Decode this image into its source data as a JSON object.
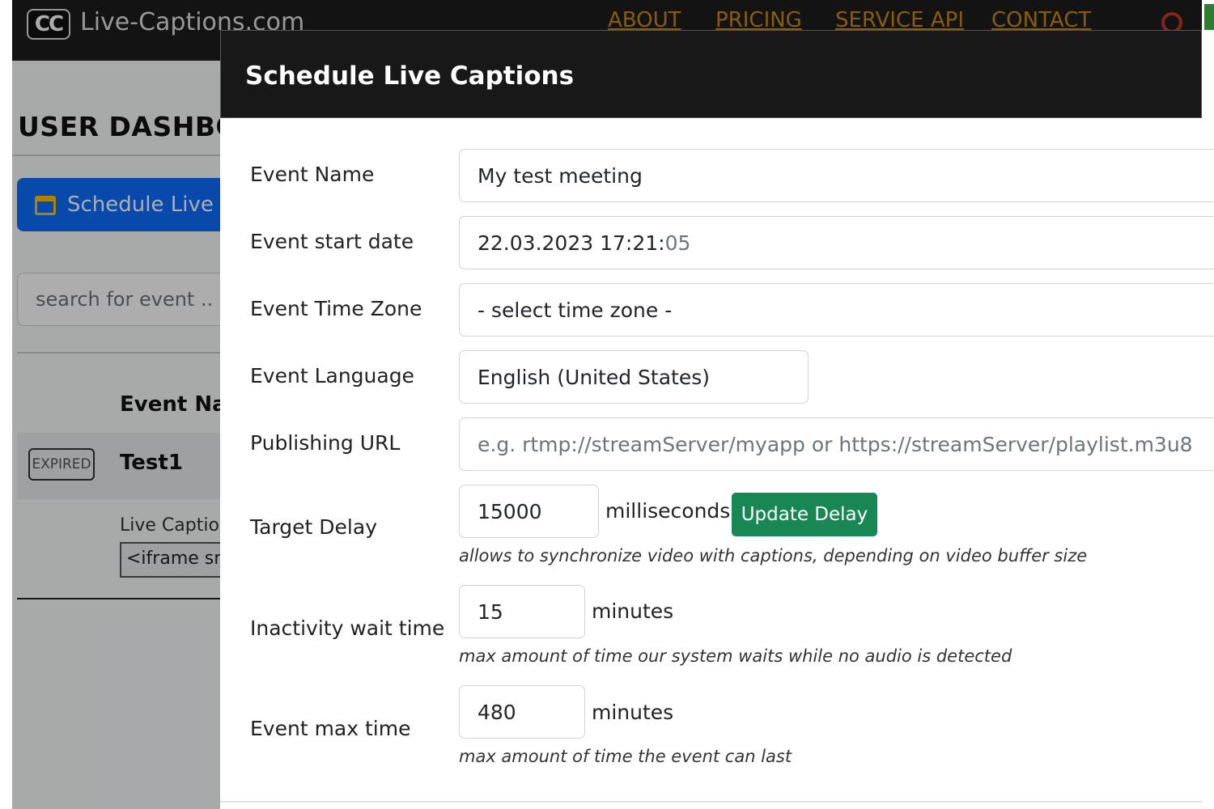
{
  "navbar": {
    "logo": "CC",
    "brand": "Live-Captions.com",
    "links": [
      "ABOUT",
      "PRICING",
      "SERVICE API",
      "CONTACT"
    ]
  },
  "dashboard": {
    "title": "USER DASHBOA",
    "schedule_button": "Schedule Live C",
    "search_placeholder": "search for event ..",
    "column_header": "Event Nar",
    "row": {
      "status": "EXPIRED",
      "name": "Test1"
    },
    "live_captions_label": "Live Caption",
    "iframe_code": "<iframe src"
  },
  "modal": {
    "title": "Schedule Live Captions",
    "fields": {
      "event_name": {
        "label": "Event Name",
        "value": "My test meeting"
      },
      "start_date": {
        "label": "Event start date",
        "value": "22.03.2023 17:21:",
        "seconds": "05"
      },
      "time_zone": {
        "label": "Event Time Zone",
        "value": "- select time zone -"
      },
      "language": {
        "label": "Event Language",
        "value": "English (United States)"
      },
      "publishing_url": {
        "label": "Publishing URL",
        "placeholder": "e.g. rtmp://streamServer/myapp or https://streamServer/playlist.m3u8"
      },
      "target_delay": {
        "label": "Target Delay",
        "value": "15000",
        "unit": "milliseconds",
        "button": "Update Delay",
        "help": "allows to synchronize video with captions, depending on video buffer size"
      },
      "inactivity": {
        "label": "Inactivity wait time",
        "value": "15",
        "unit": "minutes",
        "help": "max amount of time our system waits while no audio is detected"
      },
      "max_time": {
        "label": "Event max time",
        "value": "480",
        "unit": "minutes",
        "help": "max amount of time the event can last"
      }
    }
  },
  "colors": {
    "navbar": "#1c1c1c",
    "nav_link": "#c98a14",
    "primary": "#0d6efd",
    "success": "#198754"
  }
}
